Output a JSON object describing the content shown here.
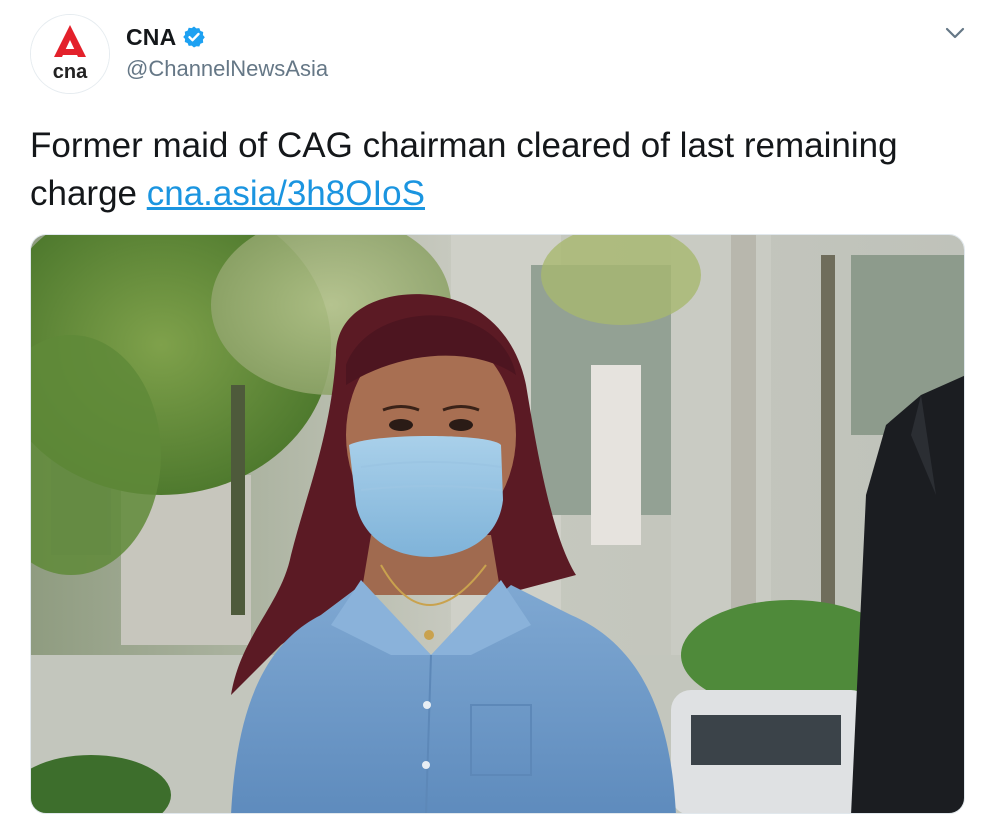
{
  "account": {
    "display_name": "CNA",
    "handle": "@ChannelNewsAsia",
    "verified": true,
    "avatar_text": "cna",
    "brand_color": "#e3212b"
  },
  "tweet": {
    "text_prefix": "Former maid of CAG chairman cleared of last remaining charge ",
    "link_text": "cna.asia/3h8OIoS",
    "link_color": "#1b95e0"
  },
  "media": {
    "type": "photo",
    "icon": "photo"
  },
  "controls": {
    "caret_icon": "chevron-down-icon"
  }
}
